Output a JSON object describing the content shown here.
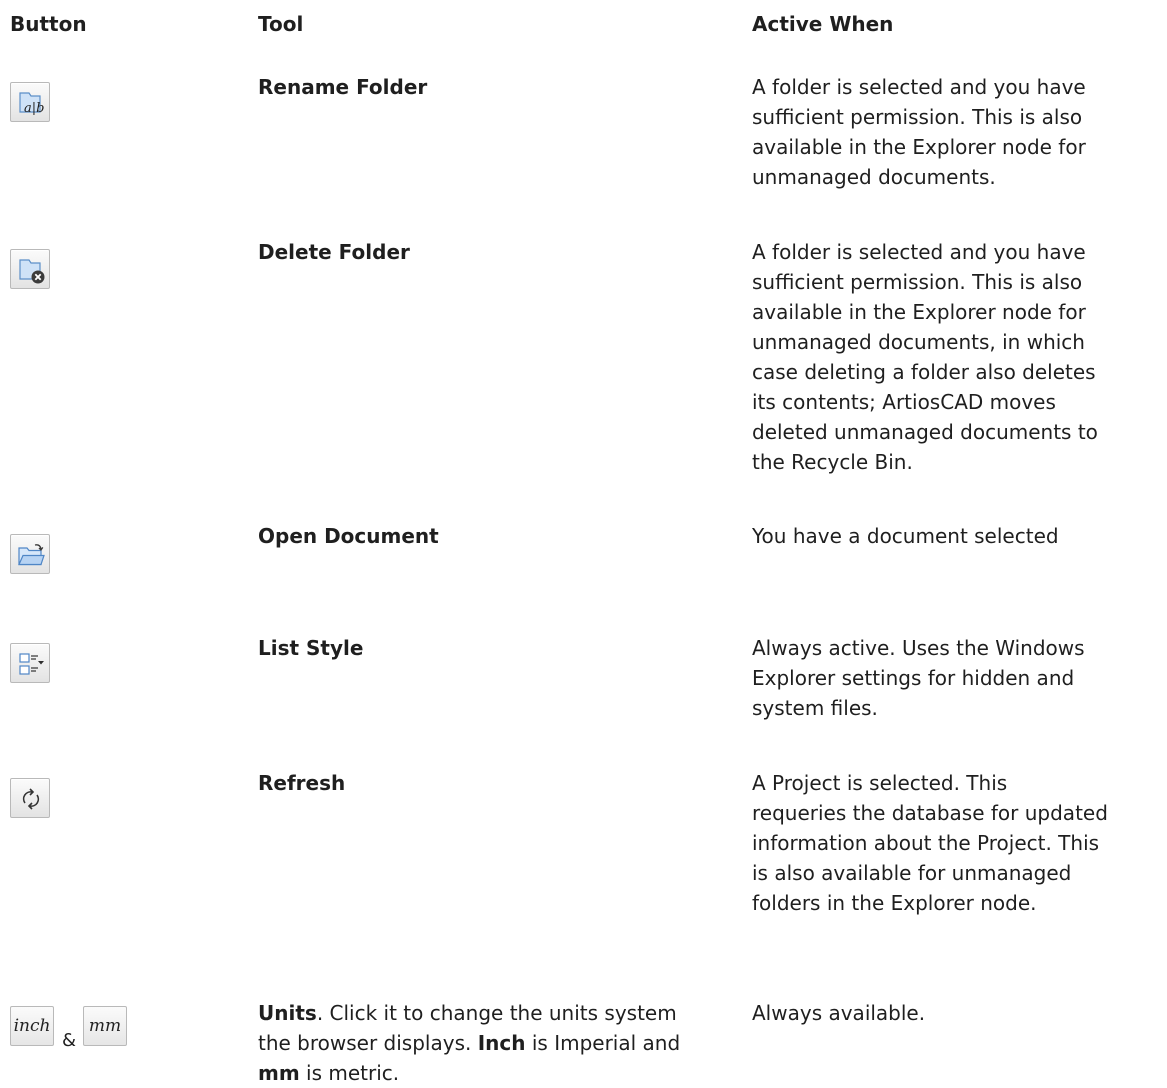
{
  "headers": {
    "button": "Button",
    "tool": "Tool",
    "active_when": "Active When"
  },
  "rows": [
    {
      "tool": "Rename Folder",
      "icon": "rename-folder-icon",
      "active_when": [
        "A folder is selected and you have",
        "sufficient permission. This is also",
        "available in the Explorer node for",
        "unmanaged documents."
      ]
    },
    {
      "tool": "Delete Folder",
      "icon": "delete-folder-icon",
      "active_when": [
        "A folder is selected and you have",
        "sufficient permission. This is also",
        "available in the Explorer node for",
        "unmanaged documents, in which",
        "case deleting a folder also deletes",
        "its contents; ArtiosCAD moves",
        "deleted unmanaged documents to",
        "the Recycle Bin."
      ]
    },
    {
      "tool": "Open Document",
      "icon": "open-document-icon",
      "active_when": [
        "You have a document selected"
      ]
    },
    {
      "tool": "List Style",
      "icon": "list-style-icon",
      "active_when": [
        "Always active. Uses the Windows",
        "Explorer settings for hidden and",
        "system files."
      ]
    },
    {
      "tool": "Refresh",
      "icon": "refresh-icon",
      "active_when": [
        "A Project is selected. This",
        "requeries the database for updated",
        "information about the Project. This",
        "is also available for unmanaged",
        "folders in the Explorer node."
      ]
    }
  ],
  "units_row": {
    "inch_button": "inch",
    "mm_button": "mm",
    "ampersand": "&",
    "tool_bold": "Units",
    "tool_line1_rest": ". Click it to change the units system",
    "tool_line2_pre": "the browser displays. ",
    "tool_line2_bold": "Inch",
    "tool_line2_post": " is Imperial and",
    "tool_line3_bold": "mm",
    "tool_line3_post": " is metric.",
    "active_when": "Always available."
  }
}
